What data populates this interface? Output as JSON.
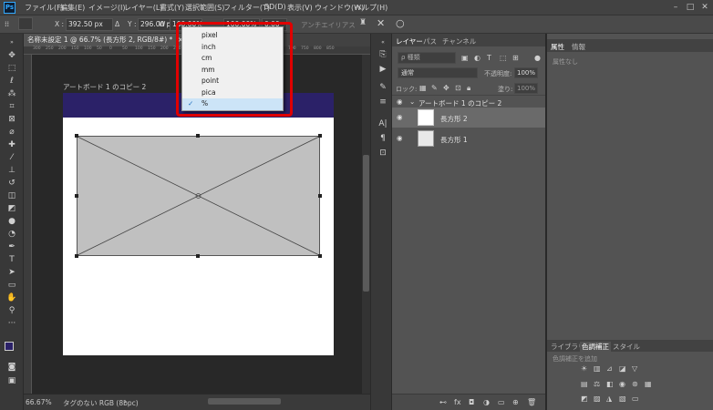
{
  "menubar": {
    "app_logo": "Ps",
    "items": [
      "ファイル(F)",
      "編集(E)",
      "イメージ(I)",
      "レイヤー(L)",
      "書式(Y)",
      "選択範囲(S)",
      "フィルター(T)",
      "3D(D)",
      "表示(V)",
      "ウィンドウ(W)",
      "ヘルプ(H)"
    ],
    "minimize": "–",
    "maximize": "□",
    "close": "✕"
  },
  "options_bar": {
    "x_label": "X :",
    "x_value": "392.50 px",
    "delta_label": "Δ",
    "y_label": "Y :",
    "y_value": "296.00 px",
    "w_label": "W :",
    "w_value": "100.00%",
    "h_value": "100.00%",
    "angle_value": "0.00",
    "antialias": "アンチエイリアス",
    "cancel_icon": "✕",
    "commit_icon": "○"
  },
  "document": {
    "tab_title": "名称未設定 1 @ 66.7% (長方形 2, RGB/8#) *",
    "tab_close": "×",
    "artboard_label": "アートボード 1 のコピー 2",
    "zoom": "66.67%",
    "status": "タグのない RGB (8bpc)"
  },
  "ruler_ticks": [
    "300",
    "250",
    "200",
    "150",
    "100",
    "50",
    "0",
    "50",
    "100",
    "150",
    "200",
    "250",
    "300",
    "350",
    "400",
    "450",
    "500",
    "550",
    "600",
    "650",
    "700",
    "750",
    "800",
    "850"
  ],
  "unit_dropdown": {
    "options": [
      "pixel",
      "inch",
      "cm",
      "mm",
      "point",
      "pica",
      "%"
    ],
    "selected": "%",
    "check": "✓"
  },
  "layers_panel": {
    "tabs": [
      "レイヤー",
      "パス",
      "チャンネル"
    ],
    "kind_placeholder": "ρ 種類",
    "blend_mode": "通常",
    "opacity_label": "不透明度:",
    "opacity_value": "100%",
    "lock_label": "ロック:",
    "fill_label": "塗り:",
    "fill_value": "100%",
    "artboard_group": "アートボード 1 のコピー 2",
    "layers": [
      "長方形 2",
      "長方形 1"
    ],
    "eye": "◉"
  },
  "properties_panel": {
    "tabs": [
      "属性",
      "情報"
    ],
    "empty_text": "属性なし"
  },
  "adjustments_panel": {
    "tabs": [
      "ライブラリ",
      "色調補正",
      "スタイル"
    ],
    "add_label": "色調補正を追加"
  },
  "colors": {
    "artboard_header": "#2b2168",
    "foreground": "#2b2168",
    "highlight": "#e00000"
  }
}
